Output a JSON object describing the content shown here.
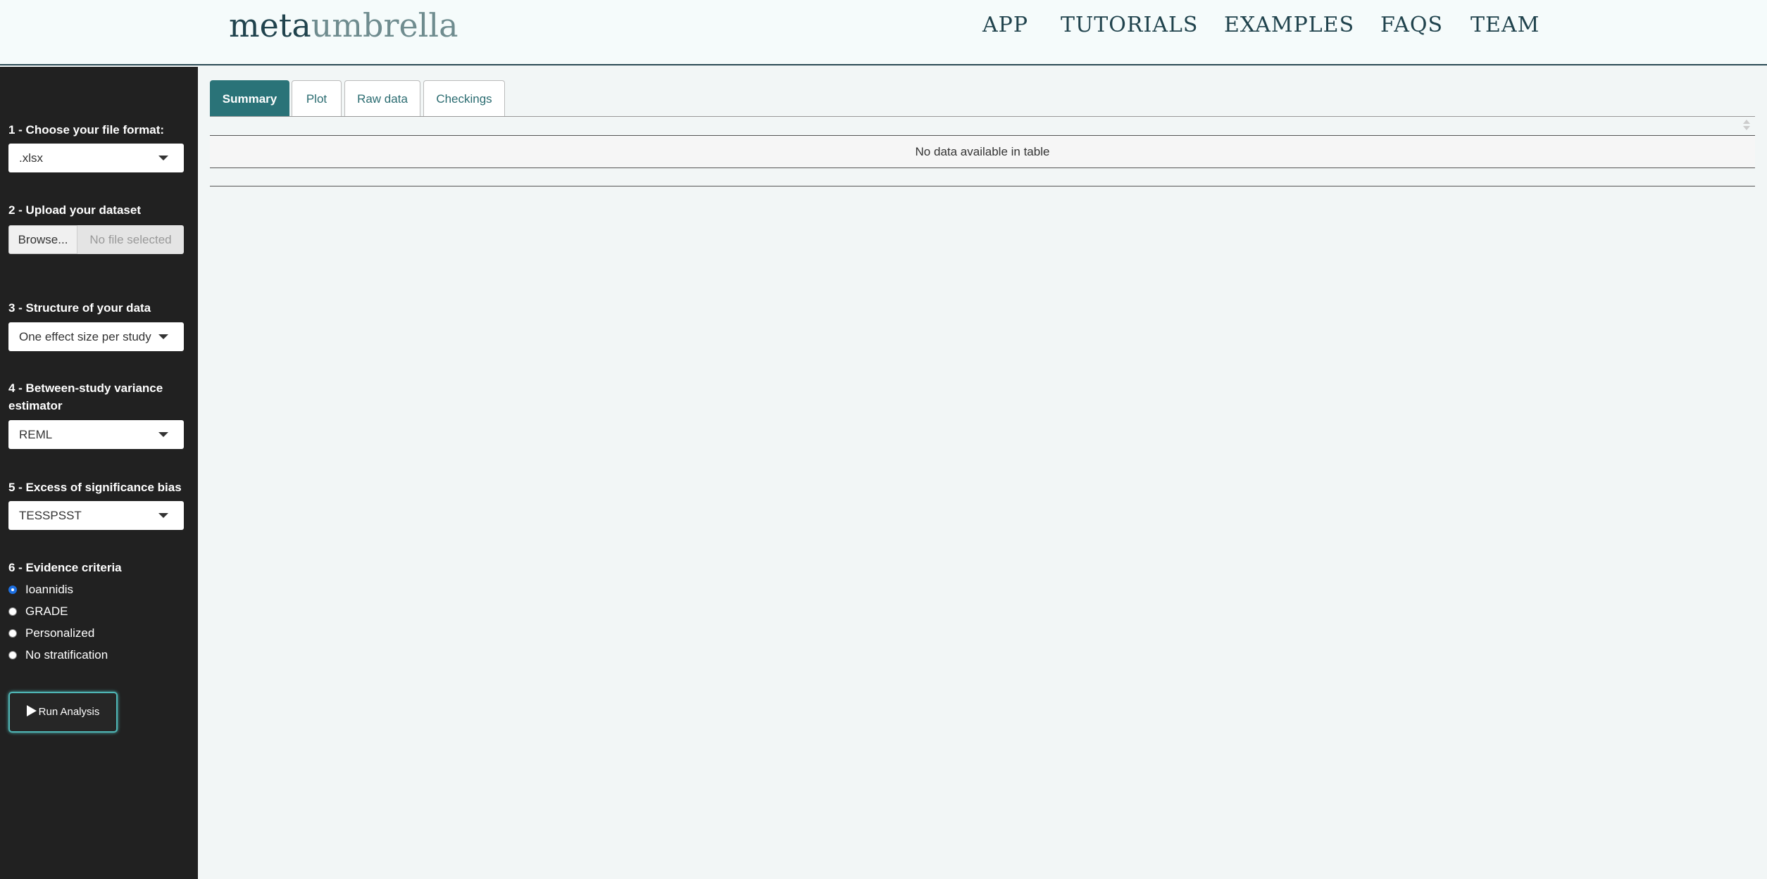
{
  "header": {
    "logo_part1": "meta",
    "logo_part2": "umbrella",
    "nav": [
      "APP",
      "TUTORIALS",
      "EXAMPLES",
      "FAQS",
      "TEAM"
    ]
  },
  "sidebar": {
    "step1_label": "1 - Choose your file format:",
    "file_format_value": ".xlsx",
    "step2_label": "2 - Upload your dataset",
    "browse_label": "Browse...",
    "no_file_text": "No file selected",
    "step3_label": "3 - Structure of your data",
    "structure_value": "One effect size per study",
    "step4_label": "4 - Between-study variance estimator",
    "estimator_value": "REML",
    "step5_label": "5 - Excess of significance bias",
    "bias_value": "TESSPSST",
    "step6_label": "6 - Evidence criteria",
    "criteria_options": [
      "Ioannidis",
      "GRADE",
      "Personalized",
      "No stratification"
    ],
    "criteria_selected": "Ioannidis",
    "run_label": "Run Analysis"
  },
  "tabs": [
    "Summary",
    "Plot",
    "Raw data",
    "Checkings"
  ],
  "active_tab": "Summary",
  "table": {
    "empty_message": "No data available in table"
  }
}
